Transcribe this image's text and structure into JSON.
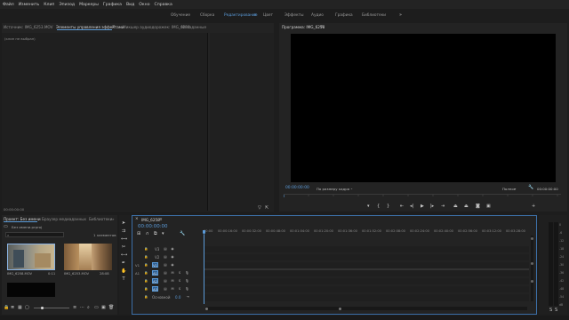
{
  "menu": [
    "Файл",
    "Изменить",
    "Клип",
    "Эпизод",
    "Маркеры",
    "Графика",
    "Вид",
    "Окно",
    "Справка"
  ],
  "workspaces": {
    "tabs": [
      "Обучение",
      "Сборка",
      "Редактирование",
      "Цвет",
      "Эффекты",
      "Аудио",
      "Графика",
      "Библиотеки"
    ],
    "active": "Редактирование",
    "more": "»"
  },
  "source_panel": {
    "tabs": [
      "Источник: IMG_6253.MOV",
      "Элементы управления эффектами",
      "Микшер аудиодорожек: IMG_6258",
      "Метаданные"
    ],
    "active_menu": "≡",
    "placeholder": "(клип не выбран)",
    "timecode": "00:00:00:00"
  },
  "program_monitor": {
    "title": "Программа: IMG_6258",
    "title_menu": "≡",
    "timecode": "00:00:00:00",
    "fit": "По размеру кадра",
    "quality": "Полное",
    "duration": "00:00:00:00"
  },
  "project_panel": {
    "tabs": [
      "Проект: Без имени",
      "Браузер медиаданных",
      "Библиотеки"
    ],
    "more": "»",
    "project_name": "Без имени.prproj",
    "item_count": "1 элементов",
    "clips": [
      {
        "name": "IMG_6258.MOV",
        "duration": "0:11"
      },
      {
        "name": "IMG_6253.MOV",
        "duration": "28:08"
      }
    ]
  },
  "timeline": {
    "sequence_name": "IMG_6258",
    "sequence_menu": "≡",
    "timecode": "00:00:00:00",
    "ruler": [
      "00:00",
      "00:00:16:00",
      "00:00:32:00",
      "00:00:48:00",
      "00:01:04:00",
      "00:01:20:00",
      "00:01:36:00",
      "00:01:52:00",
      "00:02:08:00",
      "00:02:24:00",
      "00:02:40:00",
      "00:02:56:00",
      "00:03:12:00",
      "00:03:28:00",
      "00:03:44:00"
    ],
    "video_tracks": [
      "V3",
      "V2",
      "V1"
    ],
    "audio_tracks": [
      "A1",
      "A2",
      "A3"
    ],
    "master_label": "Основной",
    "master_value": "0.0"
  },
  "meter_scale": [
    "0",
    "-6",
    "-12",
    "-18",
    "-24",
    "-30",
    "-36",
    "-42",
    "-48",
    "-54",
    "dB"
  ],
  "colors": {
    "accent": "#5b9bd9",
    "panel": "#232323",
    "background": "#1d1d1d"
  }
}
